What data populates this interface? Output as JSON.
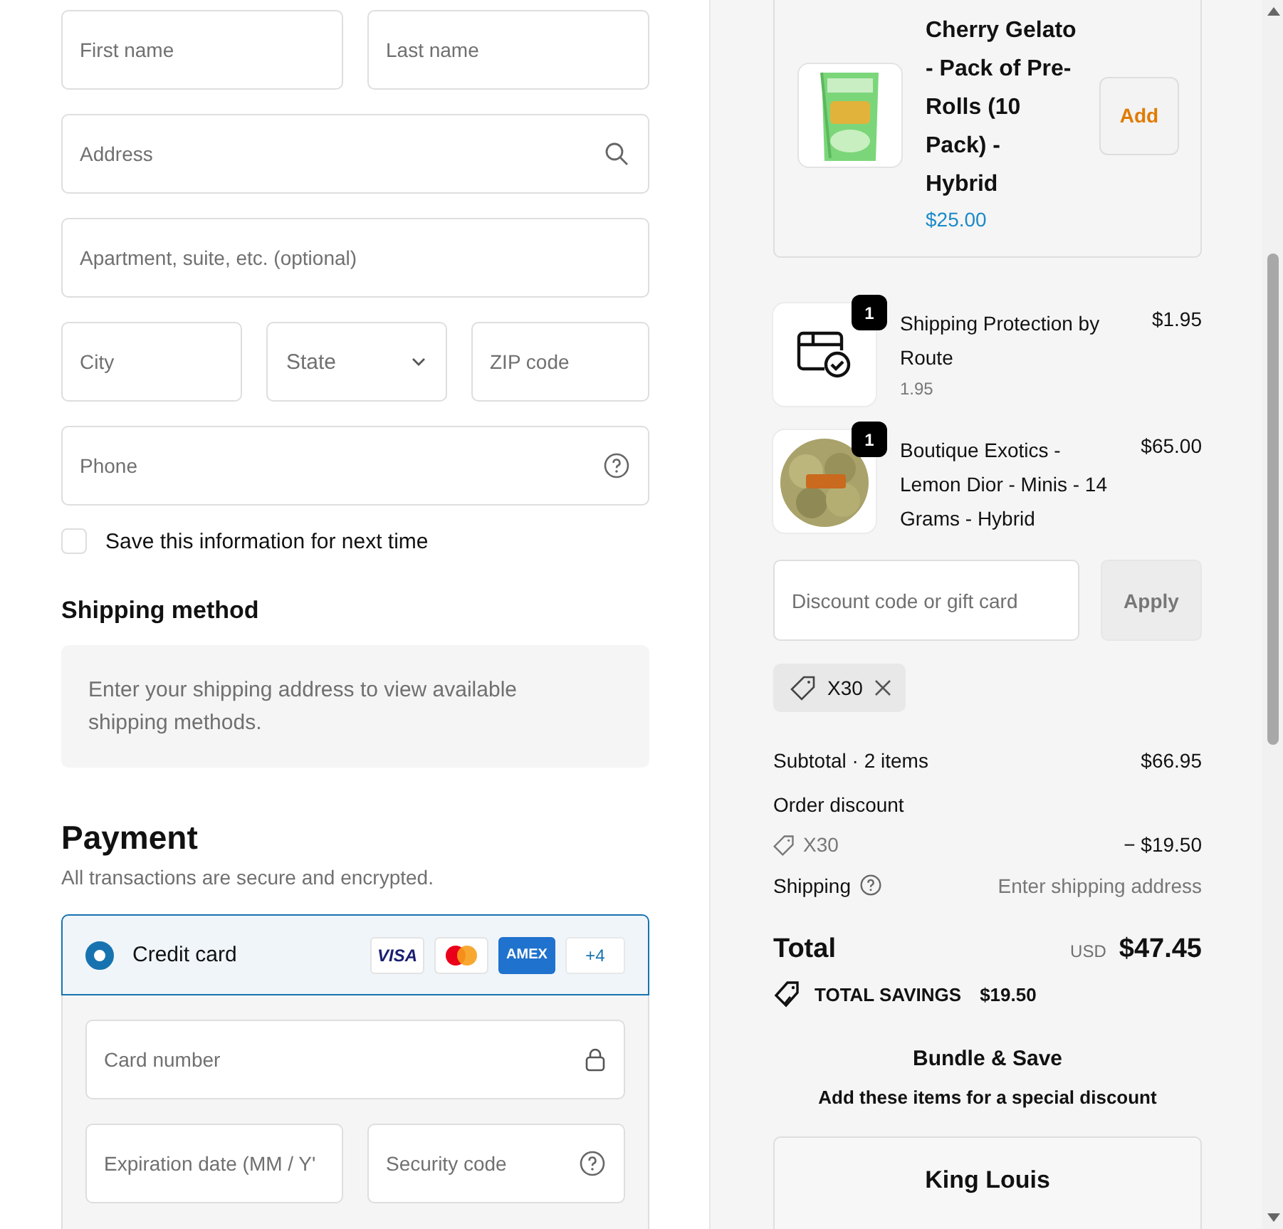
{
  "address_fields": [
    {
      "placeholder": "First name",
      "kind": "text"
    },
    {
      "placeholder": "Last name",
      "kind": "text"
    },
    {
      "placeholder": "Address",
      "kind": "search"
    },
    {
      "placeholder": "Apartment, suite, etc. (optional)",
      "kind": "text"
    },
    {
      "placeholder": "City",
      "kind": "text"
    },
    {
      "placeholder": "State",
      "kind": "select"
    },
    {
      "placeholder": "ZIP code",
      "kind": "text"
    },
    {
      "placeholder": "Phone",
      "kind": "help"
    }
  ],
  "save_info": {
    "label": "Save this information for next time",
    "checked": false
  },
  "shipping_method": {
    "heading": "Shipping method",
    "message": "Enter your shipping address to view available shipping methods."
  },
  "payment": {
    "heading": "Payment",
    "subtitle": "All transactions are secure and encrypted.",
    "methods": [
      {
        "label": "Credit card",
        "selected": true,
        "brands": [
          {
            "kind": "visa",
            "text": "VISA"
          },
          {
            "kind": "mastercard"
          },
          {
            "kind": "amex",
            "text": "AMEX"
          },
          {
            "kind": "more",
            "text": "+4"
          }
        ]
      }
    ],
    "card_fields": [
      {
        "placeholder": "Card number",
        "kind": "lock"
      },
      {
        "placeholder": "Expiration date (MM / Y'",
        "kind": "text"
      },
      {
        "placeholder": "Security code",
        "kind": "help"
      }
    ]
  },
  "upsell": {
    "title": "Cherry Gelato - Pack of Pre-Rolls (10 Pack) - Hybrid",
    "price": "$25.00",
    "button": "Add"
  },
  "line_items": [
    {
      "kind": "route",
      "quantity": "1",
      "name": "Shipping Protection by Route",
      "detail": "1.95",
      "price": "$1.95"
    },
    {
      "kind": "picture",
      "quantity": "1",
      "name": "Boutique Exotics - Lemon Dior - Minis - 14 Grams - Hybrid",
      "price": "$65.00"
    }
  ],
  "discount": {
    "placeholder": "Discount code or gift card",
    "button": "Apply",
    "applied": [
      {
        "code": "X30"
      }
    ]
  },
  "summary": {
    "subtotal_label": "Subtotal · 2 items",
    "subtotal": "$66.95",
    "discount_label": "Order discount",
    "discount_code": "X30",
    "discount_amount": "− $19.50",
    "shipping_label": "Shipping",
    "shipping_value": "Enter shipping address",
    "total_label": "Total",
    "currency": "USD",
    "total": "$47.45",
    "savings_label": "TOTAL SAVINGS",
    "savings": "$19.50"
  },
  "bundle": {
    "title": "Bundle & Save",
    "subtitle": "Add these items for a special discount",
    "product": "King Louis"
  }
}
